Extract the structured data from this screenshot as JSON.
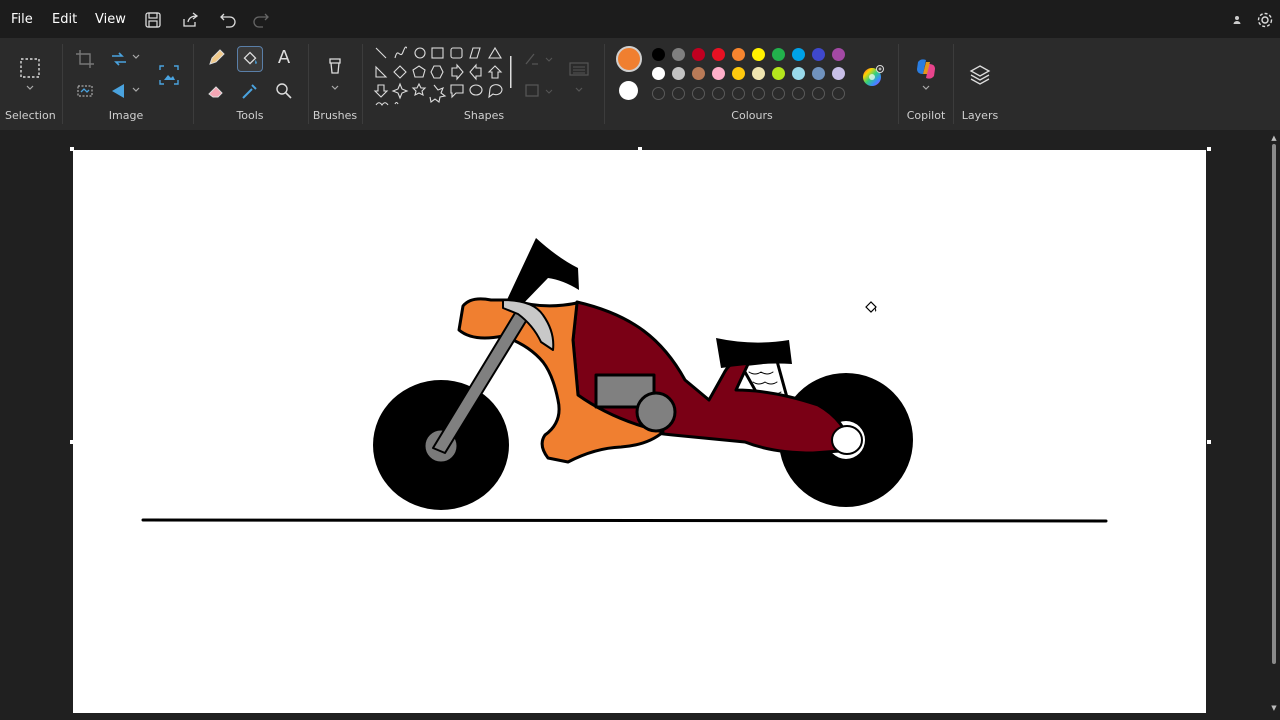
{
  "menu": {
    "file": "File",
    "edit": "Edit",
    "view": "View"
  },
  "groups": {
    "selection": "Selection",
    "image": "Image",
    "tools": "Tools",
    "brushes": "Brushes",
    "shapes": "Shapes",
    "colours": "Colours",
    "copilot": "Copilot",
    "layers": "Layers"
  },
  "text_tool_glyph": "A",
  "current_colors": {
    "primary": "#f07f30",
    "secondary": "#ffffff"
  },
  "palette": {
    "row1": [
      "#000000",
      "#7f7f7f",
      "#c00020",
      "#e81123",
      "#f7852f",
      "#fff100",
      "#22b14c",
      "#00a2e8",
      "#3f48cc",
      "#a349a4"
    ],
    "row2": [
      "#ffffff",
      "#c3c3c3",
      "#b97a57",
      "#ffaec9",
      "#ffc90e",
      "#efe4b0",
      "#b5e61d",
      "#99d9ea",
      "#7092be",
      "#c8bfe7"
    ],
    "row3_empty_count": 10
  }
}
